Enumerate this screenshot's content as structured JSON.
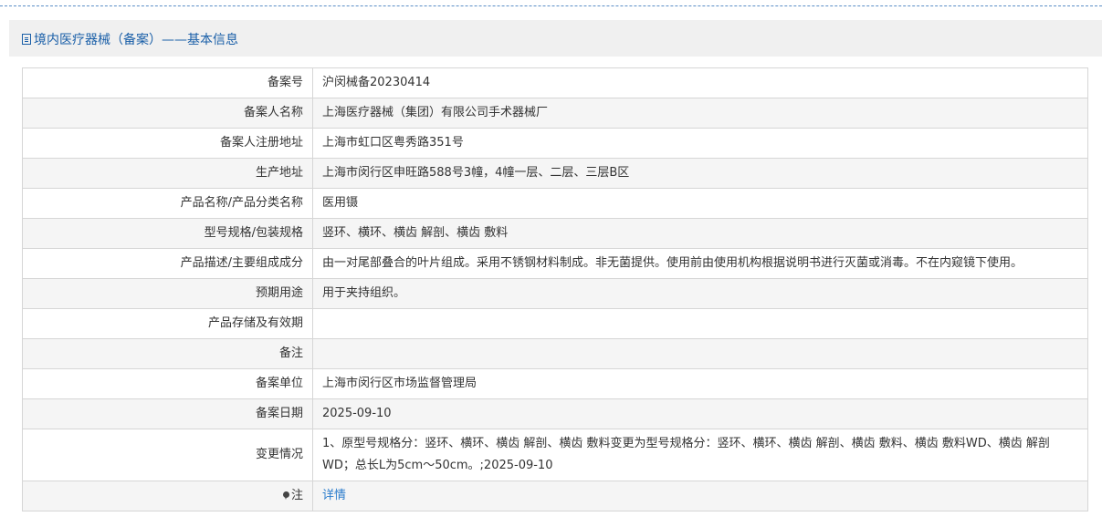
{
  "panel": {
    "title": "境内医疗器械（备案）——基本信息"
  },
  "rows": [
    {
      "label": "备案号",
      "value": "沪闵械备20230414"
    },
    {
      "label": "备案人名称",
      "value": "上海医疗器械（集团）有限公司手术器械厂"
    },
    {
      "label": "备案人注册地址",
      "value": "上海市虹口区粤秀路351号"
    },
    {
      "label": "生产地址",
      "value": "上海市闵行区申旺路588号3幢，4幢一层、二层、三层B区"
    },
    {
      "label": "产品名称/产品分类名称",
      "value": "医用镊"
    },
    {
      "label": "型号规格/包装规格",
      "value": "竖环、横环、横齿 解剖、横齿 敷料"
    },
    {
      "label": "产品描述/主要组成成分",
      "value": "由一对尾部叠合的叶片组成。采用不锈钢材料制成。非无菌提供。使用前由使用机构根据说明书进行灭菌或消毒。不在内窥镜下使用。"
    },
    {
      "label": "预期用途",
      "value": "用于夹持组织。"
    },
    {
      "label": "产品存储及有效期",
      "value": ""
    },
    {
      "label": "备注",
      "value": ""
    },
    {
      "label": "备案单位",
      "value": "上海市闵行区市场监督管理局"
    },
    {
      "label": "备案日期",
      "value": "2025-09-10"
    },
    {
      "label": "变更情况",
      "value": "1、原型号规格分：竖环、横环、横齿 解剖、横齿 敷料变更为型号规格分：竖环、横环、横齿 解剖、横齿 敷料、横齿 敷料WD、横齿 解剖WD；总长L为5cm～50cm。;2025-09-10"
    }
  ],
  "note": {
    "label": "注",
    "link": "详情",
    "icon": "map-pin-icon"
  }
}
